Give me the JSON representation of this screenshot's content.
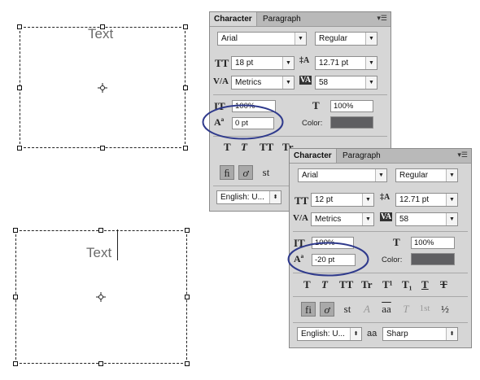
{
  "canvas": {
    "top_text": "Text",
    "bottom_text": "Text"
  },
  "panel_back": {
    "tabs": [
      "Character",
      "Paragraph"
    ],
    "menu_icon": "panel-menu-icon",
    "font_family": "Arial",
    "font_style": "Regular",
    "font_size": "18 pt",
    "leading": "12.71 pt",
    "kerning": "Metrics",
    "tracking": "58",
    "vertical_scale": "100%",
    "horizontal_scale": "100%",
    "baseline_shift": "0 pt",
    "color_label": "Color:",
    "language": "English: U...",
    "color": "#5f5f62",
    "highlight_color": "#2f3a8c"
  },
  "panel_front": {
    "tabs": [
      "Character",
      "Paragraph"
    ],
    "menu_icon": "panel-menu-icon",
    "font_family": "Arial",
    "font_style": "Regular",
    "font_size": "12 pt",
    "leading": "12.71 pt",
    "kerning": "Metrics",
    "tracking": "58",
    "vertical_scale": "100%",
    "horizontal_scale": "100%",
    "baseline_shift": "-20 pt",
    "color_label": "Color:",
    "type_styles": [
      "T",
      "T",
      "TT",
      "Tr",
      "T¹",
      "T₁",
      "T",
      "T"
    ],
    "opentype": [
      "fi",
      "ơ",
      "st",
      "A",
      "aa",
      "T",
      "1st",
      "½"
    ],
    "language": "English: U...",
    "aa_label": "aa",
    "antialias": "Sharp",
    "color": "#5f5f62",
    "highlight_color": "#2f3a8c"
  }
}
